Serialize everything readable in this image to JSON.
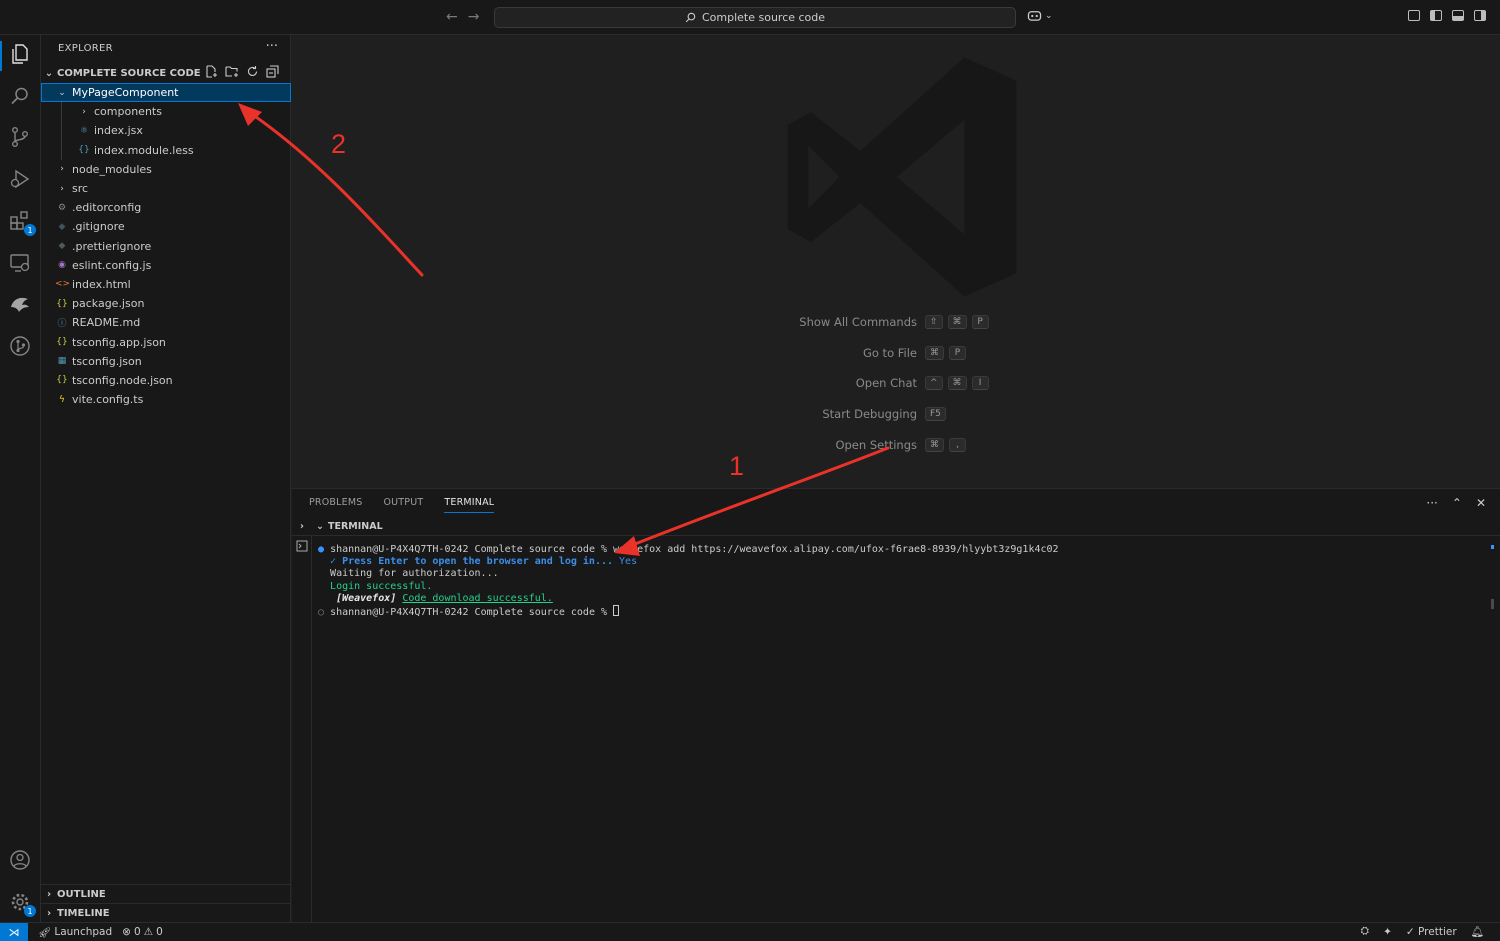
{
  "titlebar": {
    "search_text": "Complete source code",
    "back_glyph": "←",
    "forward_glyph": "→"
  },
  "activity": {
    "extensions_badge": "1",
    "settings_badge": "1",
    "icons": [
      "explorer-icon",
      "search-icon",
      "source-control-icon",
      "run-debug-icon",
      "extensions-icon",
      "remote-explorer-icon",
      "weavefox-icon",
      "gitlens-icon",
      "account-icon",
      "manage-gear-icon"
    ]
  },
  "sidebar": {
    "title": "EXPLORER",
    "more": "···",
    "section_title": "COMPLETE SOURCE CODE",
    "tree": [
      {
        "label": "MyPageComponent",
        "icon": "⌄",
        "depth": 1,
        "selected": true,
        "color": "#cccccc"
      },
      {
        "label": "components",
        "icon": "›",
        "depth": 2,
        "color": "#cccccc"
      },
      {
        "label": "index.jsx",
        "icon": "⚛",
        "depth": 2,
        "color": "#519aba"
      },
      {
        "label": "index.module.less",
        "icon": "{}",
        "depth": 2,
        "color": "#519aba"
      },
      {
        "label": "node_modules",
        "icon": "›",
        "depth": 1,
        "color": "#cccccc"
      },
      {
        "label": "src",
        "icon": "›",
        "depth": 1,
        "color": "#cccccc"
      },
      {
        "label": ".editorconfig",
        "icon": "⚙",
        "depth": 1,
        "color": "#8a8a8a"
      },
      {
        "label": ".gitignore",
        "icon": "◆",
        "depth": 1,
        "color": "#41535b"
      },
      {
        "label": ".prettierignore",
        "icon": "◆",
        "depth": 1,
        "color": "#4d5a5e"
      },
      {
        "label": "eslint.config.js",
        "icon": "◉",
        "depth": 1,
        "color": "#a074c4"
      },
      {
        "label": "index.html",
        "icon": "<>",
        "depth": 1,
        "color": "#e37933"
      },
      {
        "label": "package.json",
        "icon": "{}",
        "depth": 1,
        "color": "#cbcb41"
      },
      {
        "label": "README.md",
        "icon": "ⓘ",
        "depth": 1,
        "color": "#519aba"
      },
      {
        "label": "tsconfig.app.json",
        "icon": "{}",
        "depth": 1,
        "color": "#cbcb41"
      },
      {
        "label": "tsconfig.json",
        "icon": "▦",
        "depth": 1,
        "color": "#519aba"
      },
      {
        "label": "tsconfig.node.json",
        "icon": "{}",
        "depth": 1,
        "color": "#cbcb41"
      },
      {
        "label": "vite.config.ts",
        "icon": "ϟ",
        "depth": 1,
        "color": "#ffca28"
      }
    ],
    "outline": "OUTLINE",
    "timeline": "TIMELINE"
  },
  "editor": {
    "shortcuts": [
      {
        "label": "Show All Commands",
        "keys": [
          "⇧",
          "⌘",
          "P"
        ]
      },
      {
        "label": "Go to File",
        "keys": [
          "⌘",
          "P"
        ]
      },
      {
        "label": "Open Chat",
        "keys": [
          "^",
          "⌘",
          "I"
        ]
      },
      {
        "label": "Start Debugging",
        "keys": [
          "F5"
        ]
      },
      {
        "label": "Open Settings",
        "keys": [
          "⌘",
          ","
        ]
      }
    ]
  },
  "panel": {
    "tabs": [
      "PROBLEMS",
      "OUTPUT",
      "TERMINAL"
    ],
    "active_tab": "TERMINAL",
    "terminal_title": "TERMINAL",
    "lines": {
      "l1_prompt": "shannan@U-P4X4Q7TH-0242 Complete source code % ",
      "l1_cmd": "weavefox add https://weavefox.alipay.com/ufox-f6rae8-8939/hlyybt3z9g1k4c02",
      "l2": "✓ Press Enter to open the browser and log in... ",
      "l2_yes": "Yes",
      "l3": "Waiting for authorization...",
      "l4": "Login successful.",
      "l5_tag": "[Weavefox]",
      "l5_msg": "Code download successful.",
      "l6_prompt": "shannan@U-P4X4Q7TH-0242 Complete source code % "
    }
  },
  "statusbar": {
    "launchpad": "Launchpad",
    "errors": "0",
    "warnings": "0",
    "prettier": "Prettier"
  },
  "annotations": {
    "arrow1_label": "1",
    "arrow2_label": "2",
    "color": "#e8322a"
  }
}
